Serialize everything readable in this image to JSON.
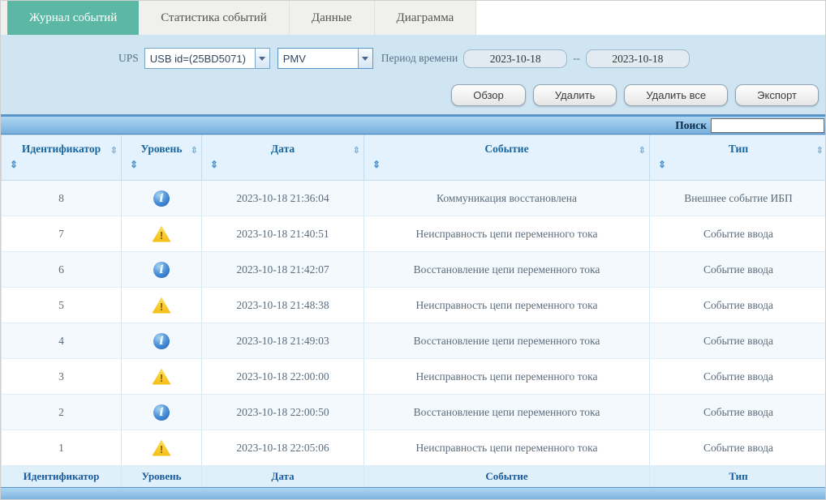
{
  "tabs": [
    {
      "label": "Журнал событий",
      "active": true
    },
    {
      "label": "Статистика событий",
      "active": false
    },
    {
      "label": "Данные",
      "active": false
    },
    {
      "label": "Диаграмма",
      "active": false
    }
  ],
  "filters": {
    "ups_label": "UPS",
    "ups_value": "USB id=(25BD5071)",
    "model_value": "PMV",
    "period_label": "Период времени",
    "date_from": "2023-10-18",
    "date_separator": "--",
    "date_to": "2023-10-18",
    "buttons": [
      {
        "label": "Обзор"
      },
      {
        "label": "Удалить"
      },
      {
        "label": "Удалить все"
      },
      {
        "label": "Экспорт"
      }
    ]
  },
  "search": {
    "label": "Поиск",
    "value": ""
  },
  "table": {
    "columns": [
      "Идентификатор",
      "Уровень",
      "Дата",
      "Событие",
      "Тип"
    ],
    "rows": [
      {
        "id": "8",
        "level": "info",
        "date": "2023-10-18 21:36:04",
        "event": "Коммуникация восстановлена",
        "type": "Внешнее событие ИБП"
      },
      {
        "id": "7",
        "level": "warning",
        "date": "2023-10-18 21:40:51",
        "event": "Неисправность цепи переменного тока",
        "type": "Событие ввода"
      },
      {
        "id": "6",
        "level": "info",
        "date": "2023-10-18 21:42:07",
        "event": "Восстановление цепи переменного тока",
        "type": "Событие ввода"
      },
      {
        "id": "5",
        "level": "warning",
        "date": "2023-10-18 21:48:38",
        "event": "Неисправность цепи переменного тока",
        "type": "Событие ввода"
      },
      {
        "id": "4",
        "level": "info",
        "date": "2023-10-18 21:49:03",
        "event": "Восстановление цепи переменного тока",
        "type": "Событие ввода"
      },
      {
        "id": "3",
        "level": "warning",
        "date": "2023-10-18 22:00:00",
        "event": "Неисправность цепи переменного тока",
        "type": "Событие ввода"
      },
      {
        "id": "2",
        "level": "info",
        "date": "2023-10-18 22:00:50",
        "event": "Восстановление цепи переменного тока",
        "type": "Событие ввода"
      },
      {
        "id": "1",
        "level": "warning",
        "date": "2023-10-18 22:05:06",
        "event": "Неисправность цепи переменного тока",
        "type": "Событие ввода"
      }
    ]
  },
  "icons": {
    "sort": "⇕",
    "dropdown": "▾",
    "info": "i-in-blue-circle",
    "warning": "exclamation-in-yellow-triangle"
  },
  "colors": {
    "active_tab": "#5cb8a4",
    "panel_blue": "#cfe5f2",
    "bar_top": "#aed6f2",
    "bar_bottom": "#78b0de",
    "header_bg": "#e3f2fc",
    "header_text": "#19669f",
    "row_alt": "#f3f9fd",
    "info_blue": "#1e58b0",
    "warning_yellow": "#f6bb0e"
  }
}
